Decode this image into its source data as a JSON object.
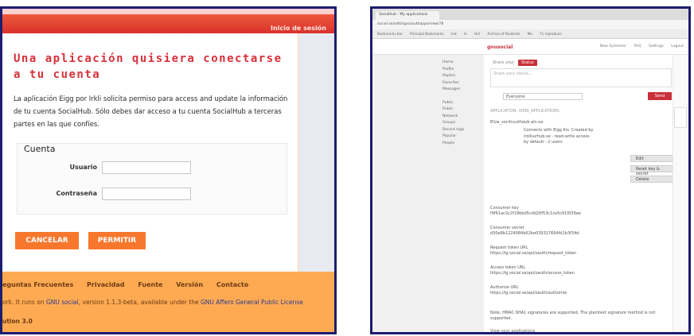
{
  "left": {
    "login_link": "Inicio de sesión",
    "title": "Una aplicación quisiera conectarse a tu cuenta",
    "description": "La aplicación Eigg por Irkli solicita permiso para access and update la información de tu cuenta SocialHub. Sólo debes dar acceso a tu cuenta SocialHub a terceras partes en las que confíes.",
    "fieldset_legend": "Cuenta",
    "username_label": "Usuario",
    "password_label": "Contraseña",
    "cancel_label": "CANCELAR",
    "allow_label": "PERMITIR",
    "footer_links": [
      "eguntas Frecuentes",
      "Privacidad",
      "Fuente",
      "Versión",
      "Contacto"
    ],
    "license_prefix": "ork. It runs on ",
    "license_link1": "GNU social",
    "license_mid": ", version 1.1.3-beta, available under the ",
    "license_link2": "GNU Affero General Public License",
    "version_line": "ution 3.0"
  },
  "right": {
    "tab_title": "Socialhub - My applications",
    "url": "social.se/settings/oauthapps/view/78",
    "bookmarks": [
      "Bookmarks bar",
      "Principal Bookmarks",
      "Ind",
      "In",
      "Hol",
      "Archive of Students",
      "Mx",
      "Tv reproducir"
    ],
    "logo": "gnusocial",
    "nav": [
      "New Systemer",
      "FAQ",
      "Settings",
      "Logout"
    ],
    "sidebar_items": [
      "Home",
      "Profile",
      "Replies",
      "Favorites",
      "Messages",
      "",
      "Public",
      "Public",
      "Network",
      "Groups",
      "Recent tags",
      "Popular",
      "People"
    ],
    "share_tab1": "Share your",
    "share_tab2": "Status",
    "share_placeholder": "Share your status...",
    "to_value": "Everyone",
    "send_label": "Send",
    "apps_title": "APPLICATION: VIEW_APPLICATIONS",
    "app_name": "Eliza_socilnuutheub.ain.oa",
    "app_meta": "Connects with Eigg Kis. Created by irollsurhub.se - read-write access by default - 2 users",
    "btn_edit": "Edit",
    "btn_reset": "Reset key & secret",
    "btn_delete": "Delete",
    "consumer_key_label": "Consumer key",
    "consumer_key_value": "f9f61ac3c2f19bbd5cdd26f53c1ce5c91f039ae",
    "consumer_secret_label": "Consumer secret",
    "consumer_secret_value": "d30e8b1224084b62be039317694fd1b3f34d",
    "request_url_label": "Request token URL",
    "request_url_value": "https://ig.social.se/api/oauth/request_token",
    "access_url_label": "Access token URL",
    "access_url_value": "https://ig.social.se/api/oauth/access_token",
    "authorize_url_label": "Authorize URL",
    "authorize_url_value": "https://ig.social.se/api/oauth/authorize",
    "note": "Note: HMAC-SHA1 signatures are supported. The plaintext signature method is not supported.",
    "view_apps": "View your applications"
  }
}
